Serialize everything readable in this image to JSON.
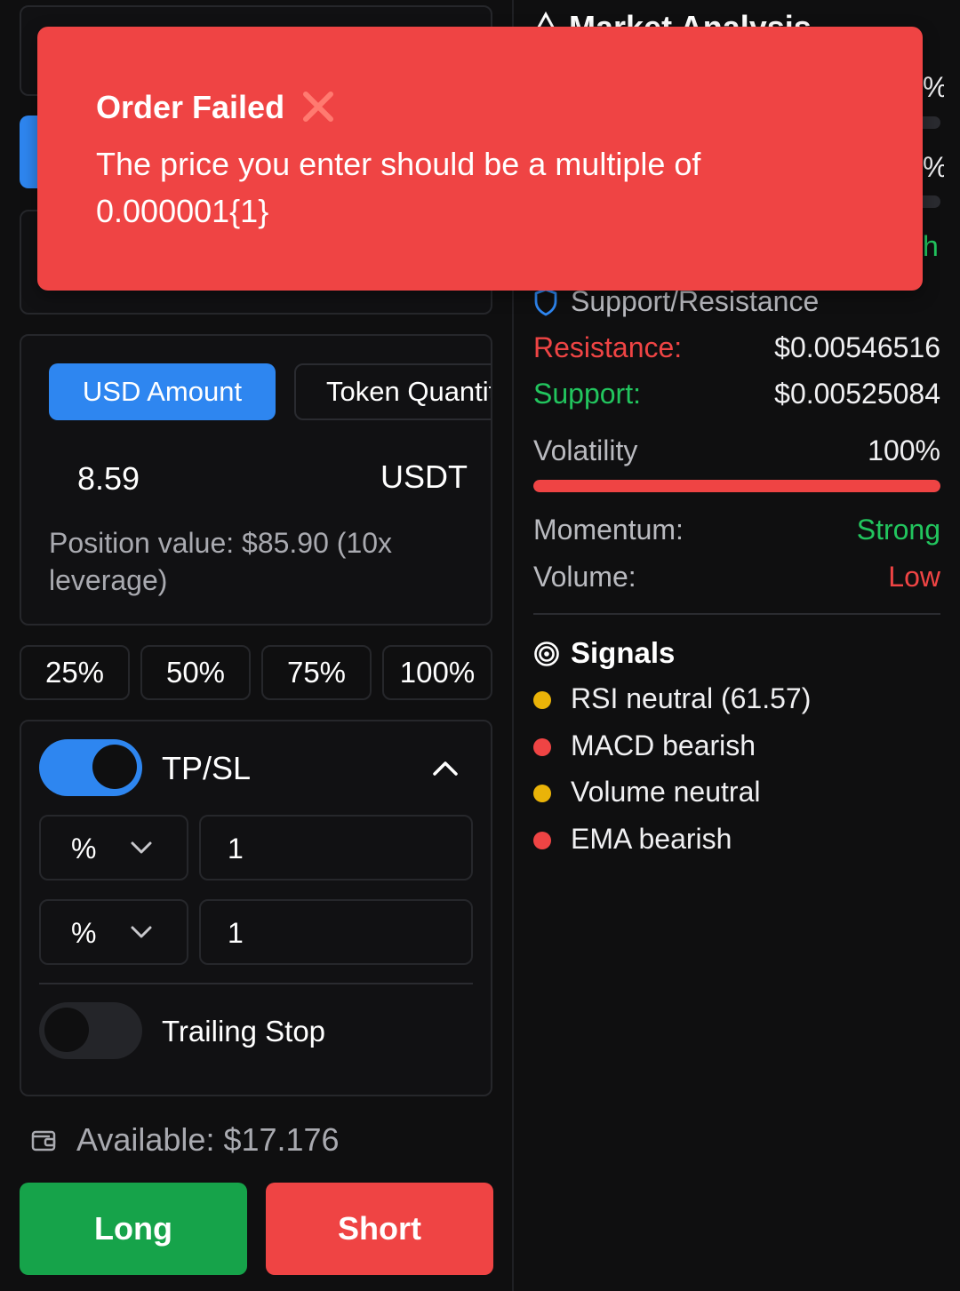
{
  "left": {
    "amount_tabs": {
      "usd_label": "USD Amount",
      "token_label": "Token Quantity"
    },
    "amount": {
      "value": "8.59",
      "unit": "USDT"
    },
    "position_value": "Position value: $85.90 (10x leverage)",
    "percent_buttons": [
      "25%",
      "50%",
      "75%",
      "100%"
    ],
    "tpsl": {
      "label": "TP/SL",
      "enabled": true,
      "take_profit": {
        "mode": "%",
        "value": "1"
      },
      "stop_loss": {
        "mode": "%",
        "value": "1"
      },
      "trailing_stop": {
        "label": "Trailing Stop",
        "enabled": false
      }
    },
    "available": "Available: $17.176",
    "long_label": "Long",
    "short_label": "Short"
  },
  "right": {
    "title": "Market Analysis",
    "partial_values": [
      "%",
      "%",
      "h"
    ],
    "support_resistance": {
      "title": "Support/Resistance",
      "resistance_label": "Resistance:",
      "resistance_value": "$0.00546516",
      "support_label": "Support:",
      "support_value": "$0.00525084"
    },
    "volatility": {
      "label": "Volatility",
      "value": "100%",
      "level": 1.0
    },
    "momentum": {
      "label": "Momentum:",
      "value": "Strong"
    },
    "volume": {
      "label": "Volume:",
      "value": "Low"
    },
    "signals": {
      "title": "Signals",
      "items": [
        {
          "text": "RSI neutral (61.57)",
          "color": "#eab308"
        },
        {
          "text": "MACD bearish",
          "color": "#ef4444"
        },
        {
          "text": "Volume neutral",
          "color": "#eab308"
        },
        {
          "text": "EMA bearish",
          "color": "#ef4444"
        }
      ]
    }
  },
  "toast": {
    "title": "Order Failed",
    "icon": "cross-mark-icon",
    "message": "The price you enter should be a multiple of 0.000001{1}"
  },
  "colors": {
    "accent_blue": "#2e86f0",
    "long_green": "#16a34a",
    "short_red": "#ef4444",
    "positive_green": "#22c55e",
    "negative_red": "#ef4444",
    "toast_red": "#ef4444"
  }
}
